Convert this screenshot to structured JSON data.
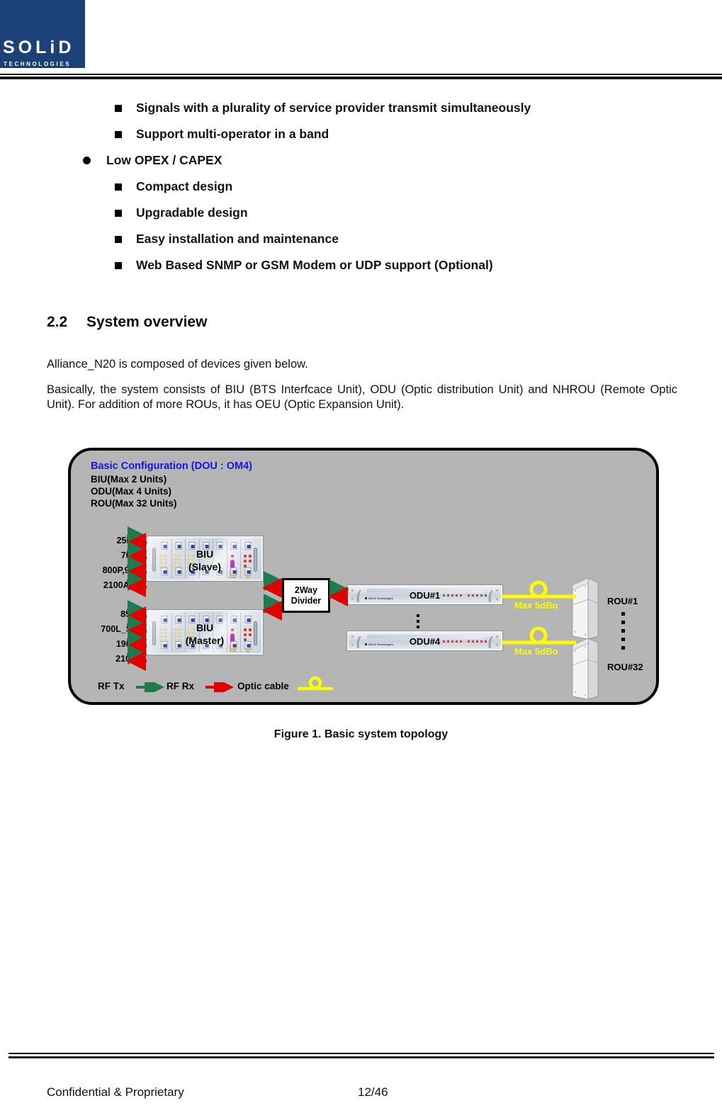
{
  "header": {
    "logo_word": "SOLiD",
    "logo_sub": "TECHNOLOGIES",
    "logo_color": "#1b4178"
  },
  "bullets": [
    {
      "level": 2,
      "marker": "square",
      "text": "Signals with a plurality of service provider transmit simultaneously"
    },
    {
      "level": 2,
      "marker": "square",
      "text": "Support multi-operator in a band"
    },
    {
      "level": 1,
      "marker": "dot",
      "text": "Low OPEX / CAPEX"
    },
    {
      "level": 2,
      "marker": "square",
      "text": "Compact design"
    },
    {
      "level": 2,
      "marker": "square",
      "text": "Upgradable design"
    },
    {
      "level": 2,
      "marker": "square",
      "text": "Easy installation and maintenance"
    },
    {
      "level": 2,
      "marker": "square",
      "text": "Web Based SNMP or GSM Modem or UDP support (Optional)"
    }
  ],
  "section": {
    "number": "2.2",
    "title": "System overview"
  },
  "paragraphs": {
    "p1": "Alliance_N20 is composed of devices given below.",
    "p2": "Basically, the system consists of BIU (BTS Interfcace Unit), ODU (Optic distribution Unit) and NHROU (Remote Optic Unit). For addition of more ROUs, it has OEU (Optic Expansion Unit)."
  },
  "diagram": {
    "title": "Basic Configuration (DOU : OM4)",
    "title_color": "#1414e6",
    "spec_lines": [
      "BIU(Max 2 Units)",
      "ODU(Max 4 Units)",
      "ROU(Max 32 Units)"
    ],
    "biu_slave": {
      "name": "BIU",
      "role": "(Slave)",
      "bands": [
        "2500T",
        "700P",
        "800P,900I",
        "2100A_M"
      ]
    },
    "biu_master": {
      "name": "BIU",
      "role": "(Master)",
      "bands": [
        "850C",
        "700L_S,M",
        "1900P",
        "2100A"
      ]
    },
    "divider": {
      "line1": "2Way",
      "line2": "Divider"
    },
    "odu": {
      "first": "ODU#1",
      "last": "ODU#4",
      "brand": "SOLiD Technologies"
    },
    "rou": {
      "first": "ROU#1",
      "last": "ROU#32"
    },
    "optic_budget": {
      "top": "Max 5dBo",
      "bottom": "Max 5dBo",
      "color": "#fcfc00"
    },
    "legend": {
      "tx": "RF Tx",
      "rx": "RF Rx",
      "optic": "Optic cable",
      "tx_color": "#1f7a4d",
      "rx_color": "#e00000",
      "optic_color": "#fcfc00"
    }
  },
  "figure_caption": "Figure 1. Basic system topology",
  "footer": {
    "confidential": "Confidential & Proprietary",
    "page": "12/46"
  }
}
